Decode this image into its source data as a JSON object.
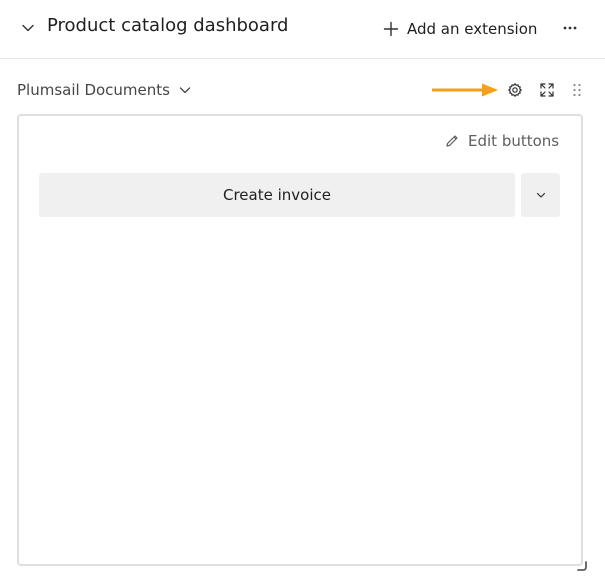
{
  "header": {
    "title": "Product catalog dashboard",
    "add_extension_label": "Add an extension",
    "icons": [
      "chevron-down-icon",
      "plus-icon",
      "more-icon"
    ]
  },
  "extension": {
    "name": "Plumsail Documents",
    "toolbar_icons": [
      "chevron-down-icon",
      "gear-icon",
      "expand-icon",
      "drag-handle-icon"
    ],
    "annotation_color": "#f2a01e"
  },
  "panel": {
    "edit_buttons_label": "Edit buttons",
    "primary_button_label": "Create invoice"
  }
}
